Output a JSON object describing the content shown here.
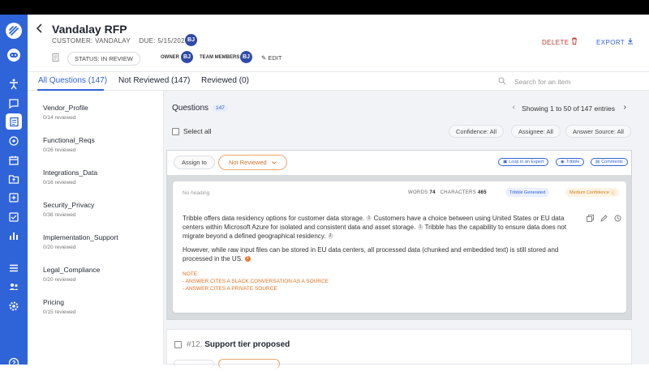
{
  "header": {
    "title": "Vandalay RFP",
    "customer": "CUSTOMER: VANDALAY",
    "due": "DUE: 5/15/2026",
    "initials": "BJ",
    "status": "STATUS: IN REVIEW",
    "owner_label": "OWNER",
    "team_label": "TEAM MEMBERS",
    "edit": "EDIT",
    "delete": "DELETE",
    "export": "EXPORT"
  },
  "tabs": [
    {
      "label": "All Questions (147)"
    },
    {
      "label": "Not Reviewed (147)"
    },
    {
      "label": "Reviewed (0)"
    }
  ],
  "search": {
    "placeholder": "Search for an item"
  },
  "sidebar": {
    "items": [
      {
        "label": "Vendor_Profile",
        "reviewed": "0/14 reviewed"
      },
      {
        "label": "Functional_Reqs",
        "reviewed": "0/26 reviewed"
      },
      {
        "label": "Integrations_Data",
        "reviewed": "0/16 reviewed"
      },
      {
        "label": "Security_Privacy",
        "reviewed": "0/38 reviewed"
      },
      {
        "label": "Implementation_Support",
        "reviewed": "0/20 reviewed"
      },
      {
        "label": "Legal_Compliance",
        "reviewed": "0/20 reviewed"
      },
      {
        "label": "Pricing",
        "reviewed": "0/15 reviewed"
      }
    ]
  },
  "main": {
    "questions_label": "Questions",
    "questions_count": "147",
    "pager": "Showing 1 to 50 of 147 entries",
    "select_all": "Select all",
    "filters": {
      "confidence": "Confidence: All",
      "assignee": "Assignee: All",
      "answer_source": "Answer Source: All"
    },
    "card": {
      "assign_to": "Assign to",
      "review_status": "Not Reviewed",
      "loop_expert": "Loop in an Expert",
      "tribble": "Tribble",
      "comments": "Comments",
      "no_heading": "No heading",
      "words_label": "WORDS",
      "words_value": "74",
      "chars_label": "CHARACTERS",
      "chars_value": "465",
      "tag_generated": "Tribble Generated",
      "tag_confidence": "Medium Confidence",
      "para1_a": "Tribble offers data residency options for customer data storage.",
      "para1_b": "Customers have a choice between using United States or EU data centers within Microsoft Azure for isolated and consistent data and asset storage.",
      "para1_c": "Tribble has the capability to ensure data does not migrate beyond a defined geographical residency.",
      "para2": "However, while raw input files can be stored in EU data centers, all processed data (chunked and embedded text) is still stored and processed in the US.",
      "cite1": "1",
      "cite2": "1",
      "cite3": "2",
      "cite4": "3",
      "note_title": "NOTE:",
      "note_line1": "- ANSWER CITES A SLACK CONVERSATION AS A SOURCE",
      "note_line2": "- ANSWER CITES A PRIVATE SOURCE"
    },
    "card2": {
      "number": "#12.",
      "title": "Support tier proposed"
    }
  },
  "colors": {
    "accent": "#2f63d8",
    "warning": "#e0701f",
    "danger": "#c0392b"
  }
}
